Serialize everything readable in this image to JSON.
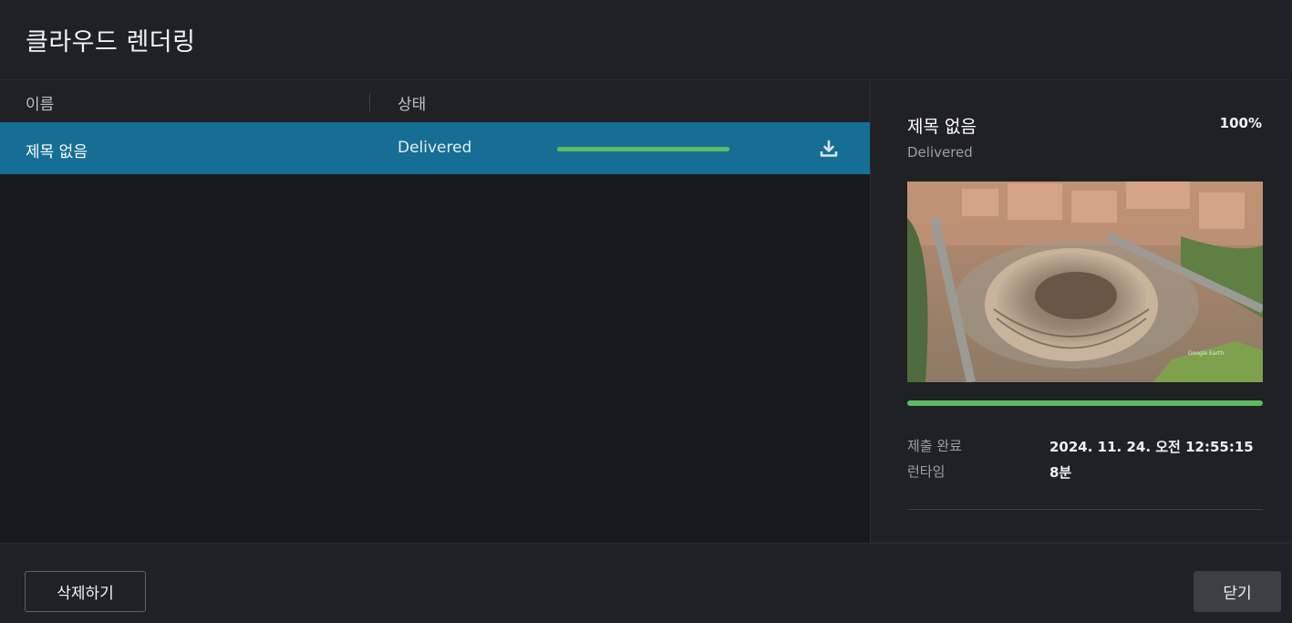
{
  "dialog": {
    "title": "클라우드 렌더링"
  },
  "columns": {
    "name": "이름",
    "status": "상태"
  },
  "rows": [
    {
      "name": "제목 없음",
      "status": "Delivered",
      "progress": 1.0
    }
  ],
  "detail": {
    "title": "제목 없음",
    "percent": "100%",
    "status": "Delivered",
    "progress": 1.0,
    "info": [
      {
        "label": "제출 완료",
        "value": "2024. 11. 24. 오전 12:55:15"
      },
      {
        "label": "런타임",
        "value": "8분"
      }
    ]
  },
  "footer": {
    "delete_label": "삭제하기",
    "close_label": "닫기"
  },
  "icons": {
    "row_download": "download-icon"
  },
  "colors": {
    "selected_row": "#166e95",
    "progress": "#5bbd62",
    "background": "#202124"
  }
}
